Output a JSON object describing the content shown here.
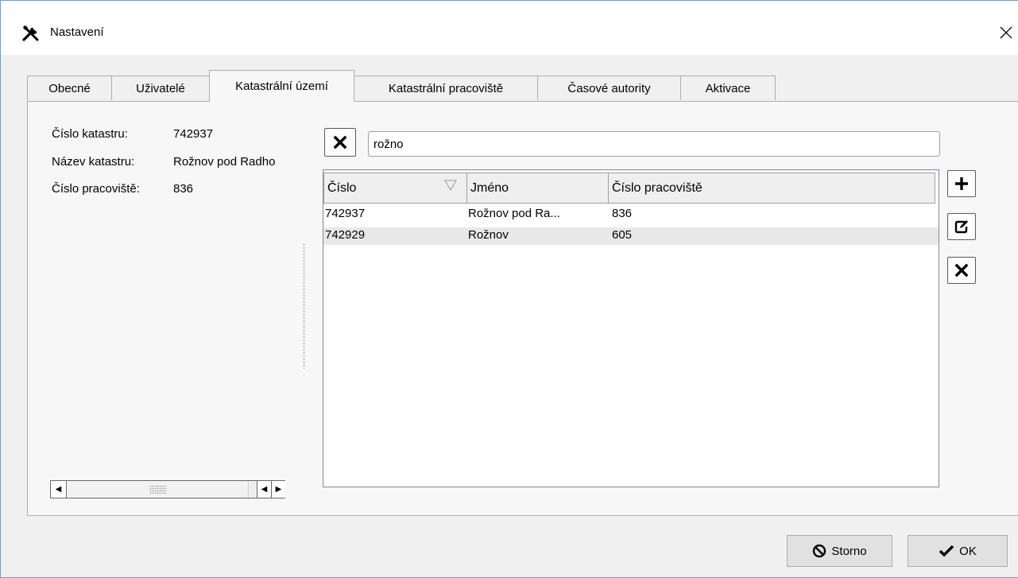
{
  "window": {
    "title": "Nastavení",
    "title_icon": "wrench-screwdriver-icon",
    "close_icon": "close-icon"
  },
  "tabs": [
    {
      "label": "Obecné",
      "active": false
    },
    {
      "label": "Uživatelé",
      "active": false
    },
    {
      "label": "Katastrální území",
      "active": true
    },
    {
      "label": "Katastrální pracoviště",
      "active": false
    },
    {
      "label": "Časové autority",
      "active": false
    },
    {
      "label": "Aktivace",
      "active": false
    }
  ],
  "details": {
    "cislo_katastru": {
      "label": "Číslo katastru:",
      "value": "742937"
    },
    "nazev_katastru": {
      "label": "Název katastru:",
      "value": "Rožnov pod Radho"
    },
    "cislo_pracoviste": {
      "label": "Číslo pracoviště:",
      "value": "836"
    }
  },
  "search": {
    "value": "rožno",
    "clear_icon": "clear-x-icon"
  },
  "table": {
    "columns": [
      "Číslo",
      "Jméno",
      "Číslo pracoviště"
    ],
    "sort_column": "Číslo",
    "rows": [
      {
        "cislo": "742937",
        "jmeno": "Rožnov pod Ra...",
        "pracoviste": "836"
      },
      {
        "cislo": "742929",
        "jmeno": "Rožnov",
        "pracoviste": "605"
      }
    ]
  },
  "actions": {
    "add_icon": "plus-icon",
    "edit_icon": "edit-icon",
    "delete_icon": "delete-x-icon"
  },
  "buttons": {
    "cancel": "Storno",
    "ok": "OK"
  },
  "colors": {
    "window_border": "#7a9cc2",
    "panel_bg": "#f7f7f7",
    "row_alt": "#e8e8e8"
  }
}
